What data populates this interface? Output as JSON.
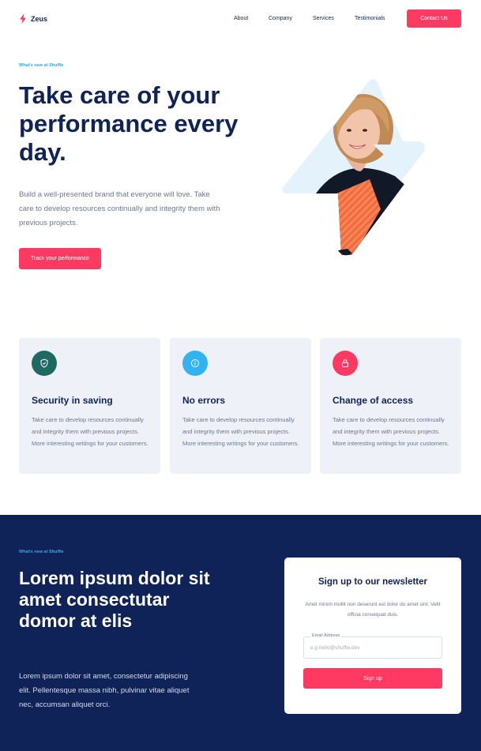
{
  "colors": {
    "accent": "#fe3a63",
    "navy": "#0f2358",
    "sky": "#31a8e8",
    "teal": "#1e6a63",
    "card_bg": "#eef2f8"
  },
  "nav": {
    "logo_icon": "lightning-icon",
    "logo_text": "Zeus",
    "links": [
      "About",
      "Company",
      "Services",
      "Testimonials"
    ],
    "cta_label": "Contact Us"
  },
  "hero": {
    "eyebrow": "What's new at Shuffle",
    "title": "Take care of your performance every day.",
    "subtitle": "Build a well-presented brand that everyone will love. Take care to develop resources continually and integrity them with previous projects.",
    "cta_label": "Track your performance"
  },
  "features": [
    {
      "icon": "shield-icon",
      "title": "Security in saving",
      "text": "Take care to develop resources continually and integrity them with previous projects. More interesting writings for your customers."
    },
    {
      "icon": "info-icon",
      "title": "No errors",
      "text": "Take care to develop resources continually and integrity them with previous projects. More interesting writings for your customers."
    },
    {
      "icon": "lock-icon",
      "title": "Change of access",
      "text": "Take care to develop resources continually and integrity them with previous projects. More interesting writings for your customers."
    }
  ],
  "newsletter_section": {
    "eyebrow": "What's new at Shuffle",
    "title": "Lorem ipsum dolor sit amet consectutar domor at elis",
    "subtitle": "Lorem ipsum dolor sit amet, consectetur adipiscing elit. Pellentesque massa nibh, pulvinar vitae aliquet nec, accumsan aliquet orci.",
    "card": {
      "title": "Sign up to our newsletter",
      "text": "Amet minim mollit non deserunt est dolor do amet sint. Velit officia consequat duis.",
      "field_label": "Email Address",
      "field_placeholder": "e.g hello@shuffle.dev",
      "field_value": "",
      "button_label": "Sign up"
    }
  }
}
